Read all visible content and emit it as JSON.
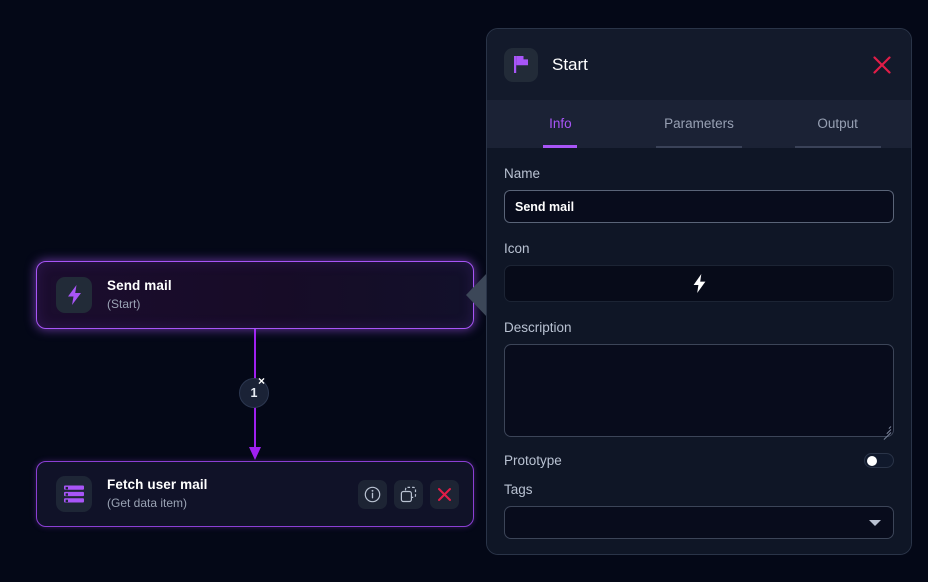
{
  "theme": {
    "canvas_bg": "#040817",
    "panel_bg": "#0f1626",
    "accent_purple": "#a855f7",
    "danger_red": "#e11d48",
    "muted_text": "#97a0b3"
  },
  "canvas": {
    "nodes": [
      {
        "id": "start",
        "title": "Send mail",
        "subtitle": "(Start)",
        "icon": "lightning-bolt-icon",
        "selected": true,
        "actions": []
      },
      {
        "id": "fetch",
        "title": "Fetch user mail",
        "subtitle": "(Get data item)",
        "icon": "data-list-icon",
        "selected": false,
        "actions": [
          {
            "name": "info-button",
            "icon": "info-circle-icon"
          },
          {
            "name": "duplicate-button",
            "icon": "duplicate-icon"
          },
          {
            "name": "delete-button",
            "icon": "close-x-icon"
          }
        ]
      }
    ],
    "connector": {
      "badge_label": "1",
      "remove_label": "×"
    }
  },
  "panel": {
    "header": {
      "icon": "flag-icon",
      "title": "Start",
      "close_icon": "close-x-icon"
    },
    "tabs": [
      {
        "label": "Info",
        "active": true
      },
      {
        "label": "Parameters",
        "active": false
      },
      {
        "label": "Output",
        "active": false
      }
    ],
    "fields": {
      "name": {
        "label": "Name",
        "value": "Send mail",
        "placeholder": ""
      },
      "icon": {
        "label": "Icon",
        "value": "lightning-bolt-icon"
      },
      "description": {
        "label": "Description",
        "value": "",
        "placeholder": ""
      },
      "prototype": {
        "label": "Prototype",
        "enabled": false
      },
      "tags": {
        "label": "Tags",
        "value": "",
        "placeholder": ""
      }
    }
  }
}
